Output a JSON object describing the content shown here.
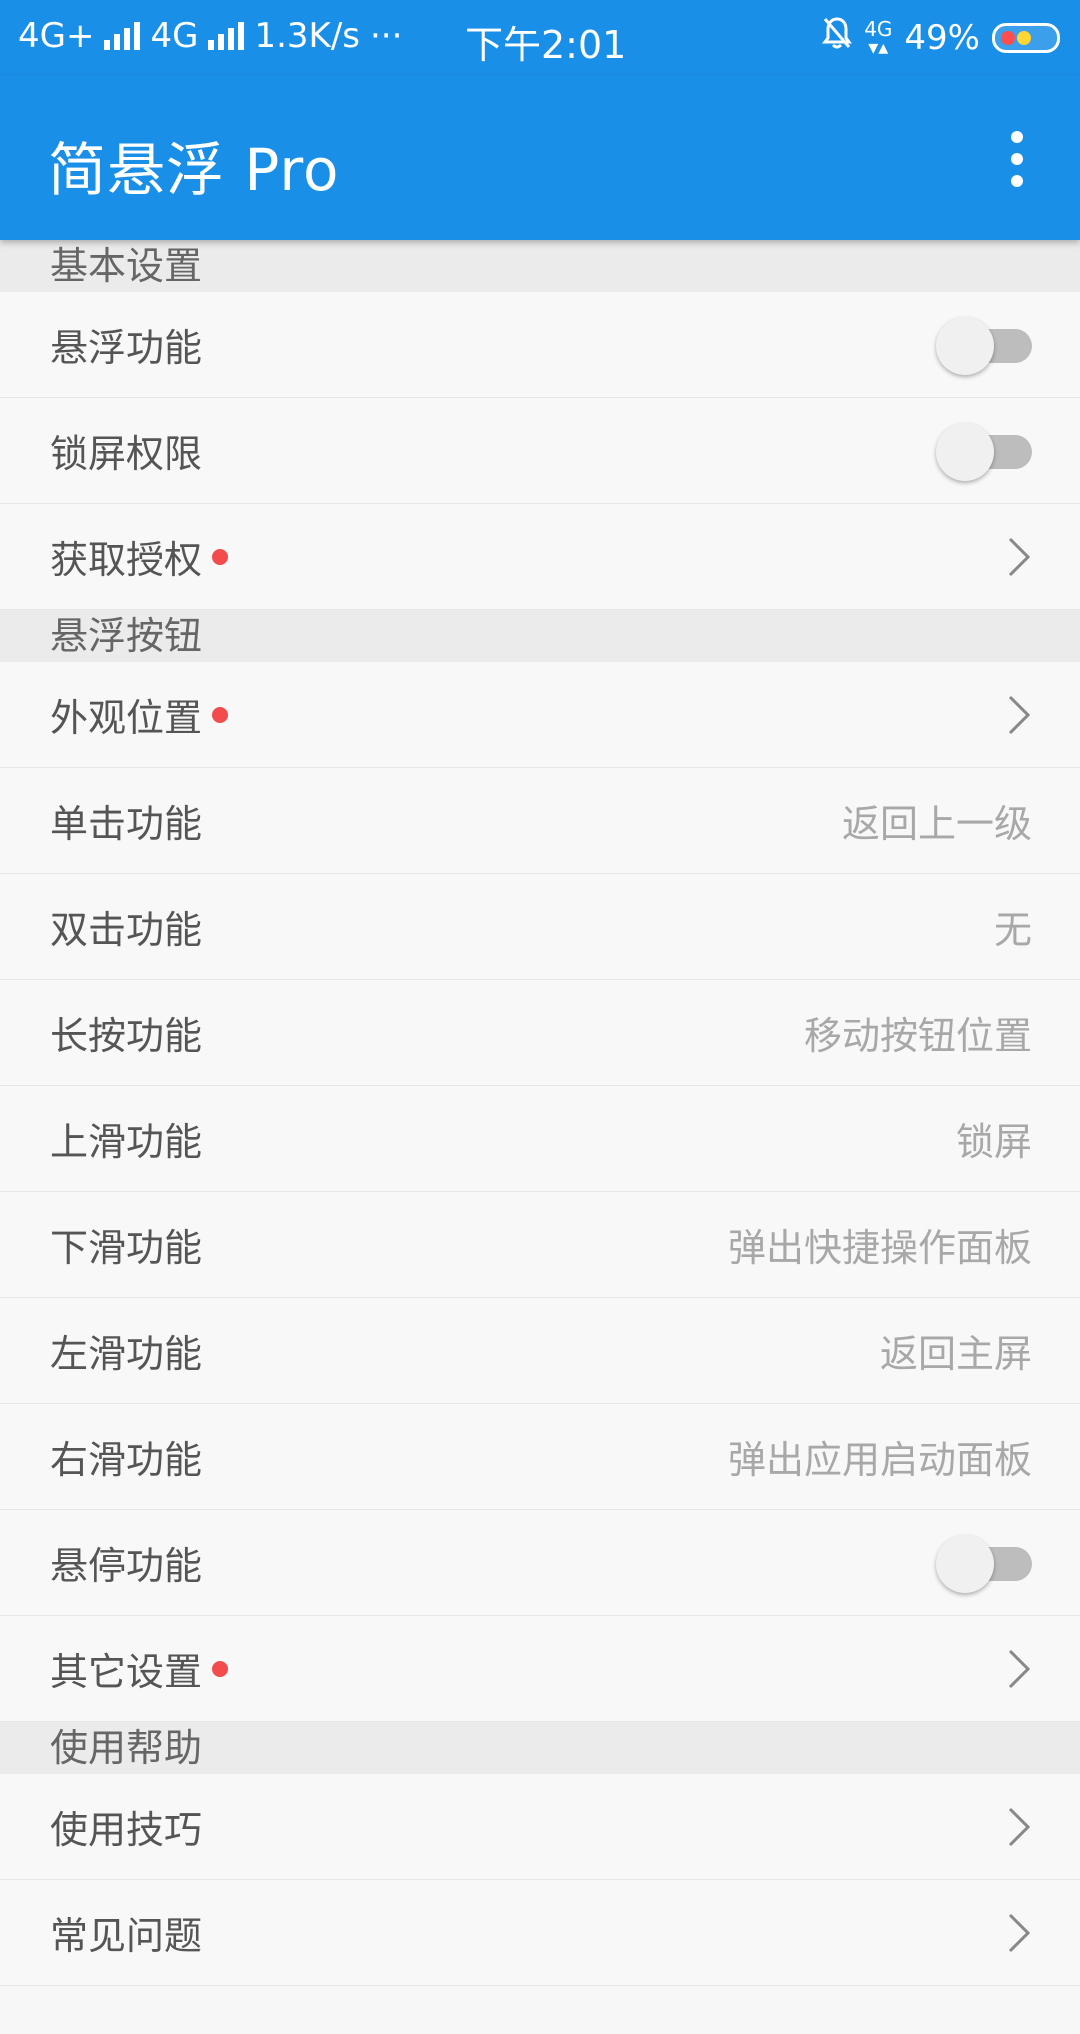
{
  "status_bar": {
    "network1": "4G+",
    "network2": "4G",
    "speed": "1.3K/s",
    "more": "···",
    "time": "下午2:01",
    "network_small": "4G",
    "battery": "49%"
  },
  "app_bar": {
    "title": "简悬浮 Pro",
    "menu_icon": "more-vert-icon"
  },
  "sections": {
    "basic": {
      "header": "基本设置",
      "items": [
        {
          "label": "悬浮功能",
          "type": "toggle",
          "on": false
        },
        {
          "label": "锁屏权限",
          "type": "toggle",
          "on": false
        },
        {
          "label": "获取授权",
          "type": "chevron",
          "dot": true
        }
      ]
    },
    "float_button": {
      "header": "悬浮按钮",
      "items": [
        {
          "label": "外观位置",
          "type": "chevron",
          "dot": true
        },
        {
          "label": "单击功能",
          "type": "value",
          "value": "返回上一级"
        },
        {
          "label": "双击功能",
          "type": "value",
          "value": "无"
        },
        {
          "label": "长按功能",
          "type": "value",
          "value": "移动按钮位置"
        },
        {
          "label": "上滑功能",
          "type": "value",
          "value": "锁屏"
        },
        {
          "label": "下滑功能",
          "type": "value",
          "value": "弹出快捷操作面板"
        },
        {
          "label": "左滑功能",
          "type": "value",
          "value": "返回主屏"
        },
        {
          "label": "右滑功能",
          "type": "value",
          "value": "弹出应用启动面板"
        },
        {
          "label": "悬停功能",
          "type": "toggle",
          "on": false
        },
        {
          "label": "其它设置",
          "type": "chevron",
          "dot": true
        }
      ]
    },
    "help": {
      "header": "使用帮助",
      "items": [
        {
          "label": "使用技巧",
          "type": "chevron"
        },
        {
          "label": "常见问题",
          "type": "chevron"
        }
      ]
    }
  },
  "colors": {
    "primary": "#1a8fe8",
    "dot": "#f24c4c",
    "value_text": "#a8a8a8"
  }
}
